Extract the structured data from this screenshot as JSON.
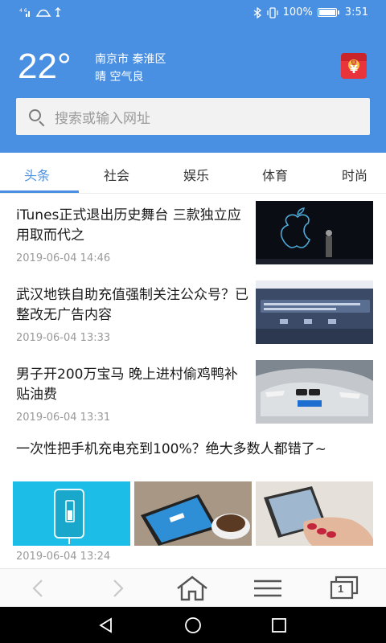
{
  "status": {
    "signal": "⁴⁶ıl",
    "battery": "100%",
    "time": "3:51"
  },
  "weather": {
    "temperature": "22°",
    "city": "南京市 秦淮区",
    "condition": "晴 空气良"
  },
  "search": {
    "placeholder": "搜索或输入网址"
  },
  "tabs": [
    "头条",
    "社会",
    "娱乐",
    "体育",
    "时尚"
  ],
  "news": [
    {
      "title": "iTunes正式退出历史舞台 三款独立应用取而代之",
      "time": "2019-06-04 14:46",
      "thumb": "apple-keynote"
    },
    {
      "title": "武汉地铁自助充值强制关注公众号？已整改无广告内容",
      "time": "2019-06-04 13:33",
      "thumb": "metro-screen"
    },
    {
      "title": "男子开200万宝马 晚上进村偷鸡鸭补贴油费",
      "time": "2019-06-04 13:31",
      "thumb": "bmw-car"
    },
    {
      "title": "一次性把手机充电充到100%？绝大多数人都错了~",
      "time": "2019-06-04 13:24",
      "images": [
        "phone-charging",
        "phone-coffee",
        "phone-hand"
      ]
    }
  ],
  "navbar": {
    "back": "back-icon",
    "forward": "forward-icon",
    "home": "home-icon",
    "menu": "menu-icon",
    "tabs_count": "1"
  },
  "colors": {
    "accent": "#4a90e2",
    "text": "#1a1a1a",
    "muted": "#999999"
  }
}
